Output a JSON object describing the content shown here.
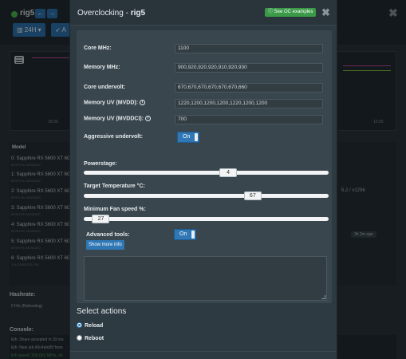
{
  "background": {
    "rig_name": "rig5",
    "range_button": "24H ▾",
    "action_button": "A",
    "chart_ticks": [
      "15:00",
      "12:00"
    ],
    "table_header": "Model",
    "gpus": [
      {
        "name": "0: Sapphire RX 5600 XT 6GB",
        "sub": "BITBY.RU MODDED"
      },
      {
        "name": "1: Sapphire RX 5600 XT 6GB",
        "sub": "BITBY.RU MODDED"
      },
      {
        "name": "2: Sapphire RX 5600 XT 6GB",
        "sub": "BITBY.RU MODDED"
      },
      {
        "name": "3: Sapphire RX 5600 XT 6GB",
        "sub": "BITBY.RU MODDED"
      },
      {
        "name": "4: Sapphire RX 5600 XT 6GB",
        "sub": "BITBY.RU MODDED"
      },
      {
        "name": "5: Sapphire RX 5600 XT 6GB",
        "sub": "BITBY.RU MODDED"
      },
      {
        "name": "6: Sapphire RX 5600 XT 6GB",
        "sub": "113-D1850122-O06"
      }
    ],
    "driver_text": "5.2 / v1296",
    "ago_badge": "3h 2m ago",
    "hashrate_label": "Hashrate:",
    "hashrate_value": "0 H/s (Rebooting)",
    "console_label": "Console:",
    "console_lines": [
      "Eth: Share accepted in 33 ms",
      "Eth: New job #0c4ebd5f from",
      "Eth speed: 205.002 MH/s, sh"
    ]
  },
  "modal": {
    "title_prefix": "Overclocking - ",
    "title_rig": "rig5",
    "examples_badge": "See OC examples",
    "close_glyph": "✖",
    "fields": {
      "core_mhz": {
        "label": "Core MHz:",
        "value": "1100"
      },
      "memory_mhz": {
        "label": "Memory MHz:",
        "value": "900,920,920,920,910,920,930"
      },
      "core_undervolt": {
        "label": "Core undervolt:",
        "value": "670,670,670,670,670,670,660"
      },
      "memory_uv_mvdd": {
        "label": "Memory UV (MVDD):",
        "value": "1220,1200,1200,1200,1220,1200,1200"
      },
      "memory_uv_mvddci": {
        "label": "Memory UV (MVDDCI):",
        "value": "700"
      }
    },
    "aggressive_undervolt": {
      "label": "Aggressive undervolt:",
      "state": "On"
    },
    "powerstage": {
      "label": "Powerstage:",
      "value": "4",
      "fraction": 0.59
    },
    "target_temp": {
      "label": "Target Temperature °C:",
      "value": "67",
      "fraction": 0.69
    },
    "min_fan": {
      "label": "Minimum Fan speed %:",
      "value": "27",
      "fraction": 0.07
    },
    "advanced_tools": {
      "label": "Advanced tools:",
      "state": "On",
      "more_button": "Show more info"
    },
    "select_actions": {
      "title": "Select actions",
      "options": [
        {
          "label": "Reload",
          "selected": true
        },
        {
          "label": "Reboot",
          "selected": false
        }
      ]
    }
  },
  "colors": {
    "accent": "#2f77b5",
    "badge_green": "#3b9a48",
    "status_green": "#4fbf4f"
  }
}
